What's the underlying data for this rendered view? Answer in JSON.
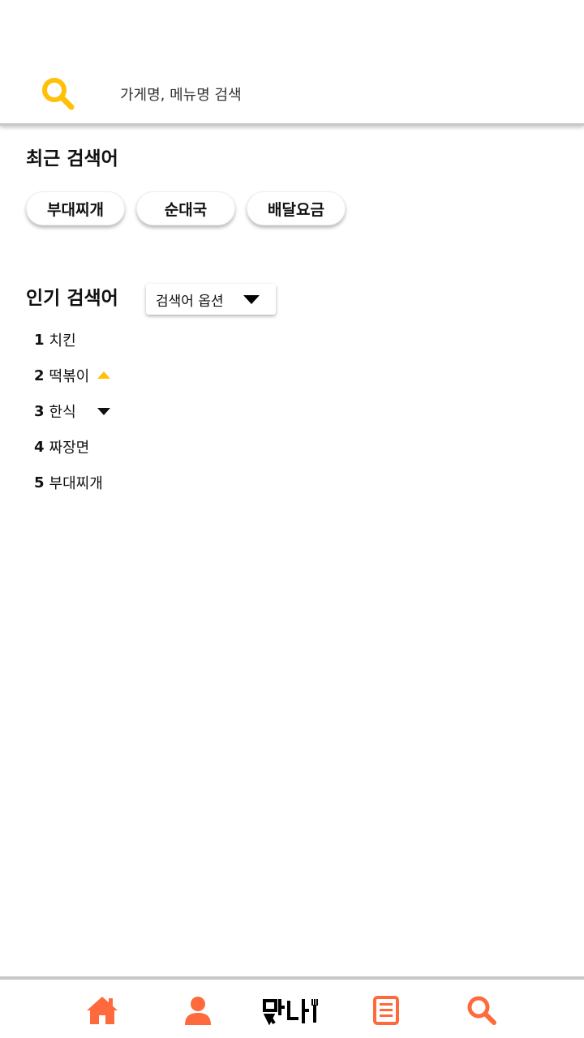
{
  "search": {
    "placeholder": "가게명, 메뉴명 검색",
    "icon": "search-icon",
    "accent": "#FFC107"
  },
  "recent": {
    "title": "최근 검색어",
    "chips": [
      "부대찌개",
      "순대국",
      "배달요금"
    ]
  },
  "popular": {
    "title": "인기 검색어",
    "option_label": "검색어 옵션",
    "items": [
      {
        "rank": "1",
        "label": "치킨",
        "trend": "none"
      },
      {
        "rank": "2",
        "label": "떡볶이",
        "trend": "up"
      },
      {
        "rank": "3",
        "label": "한식",
        "trend": "down"
      },
      {
        "rank": "4",
        "label": "짜장면",
        "trend": "none"
      },
      {
        "rank": "5",
        "label": "부대찌개",
        "trend": "none"
      }
    ]
  },
  "nav": {
    "color": "#FF6A3D",
    "items": [
      "home-icon",
      "user-icon",
      "logo",
      "list-icon",
      "search-icon"
    ],
    "logo_text": "맛나"
  }
}
